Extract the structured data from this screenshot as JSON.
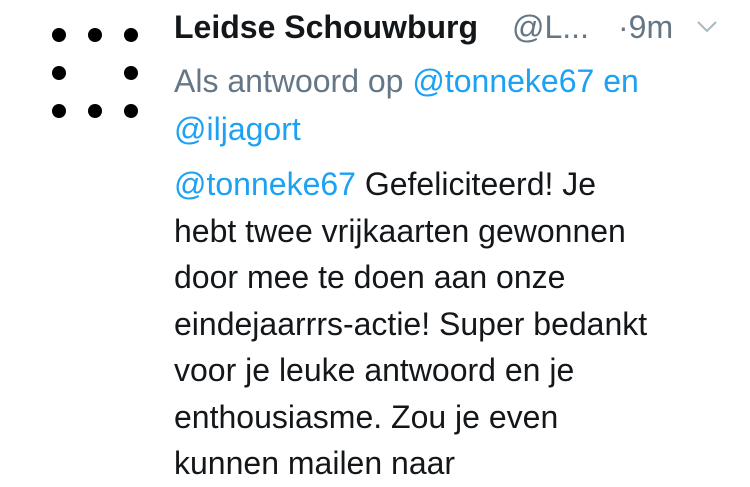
{
  "tweet": {
    "display_name": "Leidse Schouwburg",
    "handle": "@L...",
    "timestamp": "·9m",
    "reply_prefix": "Als antwoord op",
    "reply_user_1": "@tonneke67",
    "reply_conjunction": "en",
    "reply_user_2": "@iljagort",
    "mention": "@tonneke67",
    "body_lines": [
      "Gefeliciteerd! Je",
      "hebt twee vrijkaarten gewonnen",
      "door mee te doen aan onze",
      "eindejaarrrs-actie! Super bedankt",
      "voor je leuke antwoord en je",
      "enthousiasme. Zou je even",
      "kunnen mailen naar"
    ]
  },
  "icons": {
    "avatar": "dot-grid-logo",
    "menu": "chevron-down-icon"
  },
  "colors": {
    "link": "#1da1f2",
    "secondary_text": "#657786",
    "primary_text": "#14171a"
  }
}
